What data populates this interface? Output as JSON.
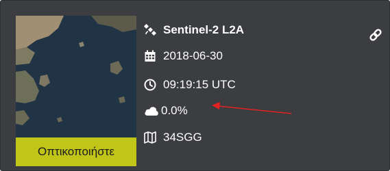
{
  "result": {
    "satellite": "Sentinel-2 L2A",
    "date": "2018-06-30",
    "time": "09:19:15 UTC",
    "cloud_cover": "0.0%",
    "tile": "34SGG",
    "view_button_label": "Οπτικοποιήστε"
  },
  "icons": {
    "satellite": "satellite-icon",
    "date": "calendar-icon",
    "time": "clock-icon",
    "cloud": "cloud-icon",
    "tile": "map-icon",
    "link": "link-icon"
  },
  "colors": {
    "card_background": "#3b3d41",
    "view_button": "#c1c518",
    "annotation_arrow": "#e32222",
    "text": "#ffffff"
  }
}
